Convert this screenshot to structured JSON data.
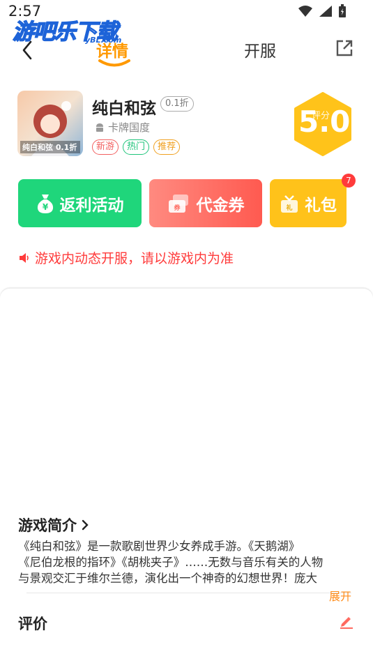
{
  "status_bar": {
    "time": "2:57"
  },
  "watermark": {
    "text": "游吧乐下载",
    "sub": "yBL.com"
  },
  "nav": {
    "tab_detail": "详情",
    "tab_server": "开服"
  },
  "game": {
    "name": "纯白和弦",
    "discount": "0.1折",
    "icon_label": "纯白和弦 0.1折",
    "platform": "卡牌国度",
    "tags": [
      "新游",
      "热门",
      "推荐"
    ]
  },
  "score": {
    "label": "评分",
    "value": "5.0"
  },
  "actions": {
    "rebate": "返利活动",
    "voucher": "代金券",
    "gift": "礼包",
    "gift_badge": "7"
  },
  "notice": {
    "text": "游戏内动态开服，请以游戏内为准"
  },
  "intro": {
    "title": "游戏简介",
    "lines": [
      "《纯白和弦》是一款歌剧世界少女养成手游。《天鹅湖》",
      "《尼伯龙根的指环》《胡桃夹子》……无数与音乐有关的人物",
      "与景观交汇于维尔兰德，演化出一个神奇的幻想世界！庞大"
    ],
    "expand": "展开"
  },
  "review": {
    "title": "评价"
  },
  "colors": {
    "accent_orange": "#ff9900",
    "rebate_green": "#1fd67b",
    "voucher_red": "#ff5a50",
    "gift_yellow": "#ffc21a",
    "notice_red": "#ff3b3b"
  },
  "icons": {
    "back": "chevron-left-icon",
    "share": "share-external-icon",
    "android": "android-icon",
    "rebate": "money-bag-icon",
    "voucher": "ticket-icon",
    "gift": "gift-box-icon",
    "speaker": "speaker-icon",
    "chevron": "chevron-right-icon",
    "edit": "pencil-icon"
  }
}
